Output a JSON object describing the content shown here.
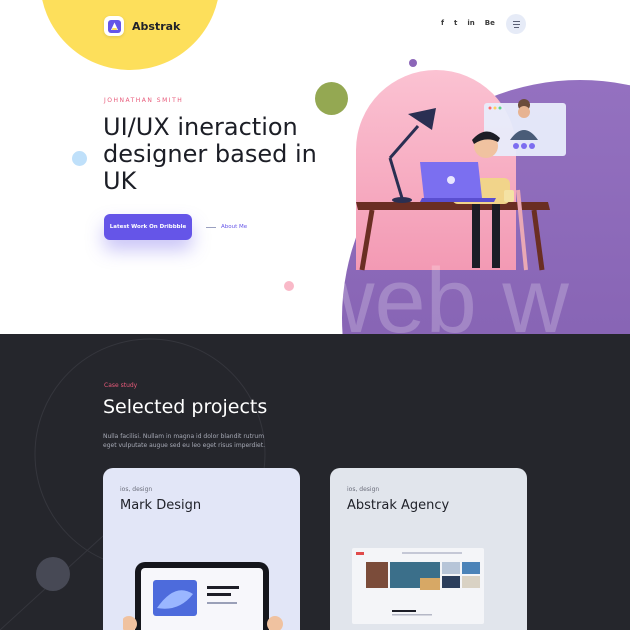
{
  "brand": {
    "name": "Abstrak"
  },
  "social": [
    "f",
    "t",
    "in",
    "Be"
  ],
  "hero": {
    "eyebrow": "JOHNATHAN SMITH",
    "headline": "UI/UX ineraction designer based in UK",
    "primary_cta": "Latest Work On Dribbble",
    "secondary_link": "About Me",
    "watermark": "web w"
  },
  "projects": {
    "label": "Case study",
    "title": "Selected projects",
    "description": "Nulla facilisi. Nullam in magna id dolor blandit rutrum eget vulputate augue sed eu leo eget risus imperdiet.",
    "cards": [
      {
        "tag": "ios, design",
        "title": "Mark Design"
      },
      {
        "tag": "ios, design",
        "title": "Abstrak Agency"
      }
    ]
  },
  "colors": {
    "accent": "#6555e8",
    "yellow": "#fddf5b",
    "purple": "#8c66b8",
    "pink": "#f9b9c8",
    "dark": "#25262c",
    "eyebrow": "#e85a7a"
  }
}
